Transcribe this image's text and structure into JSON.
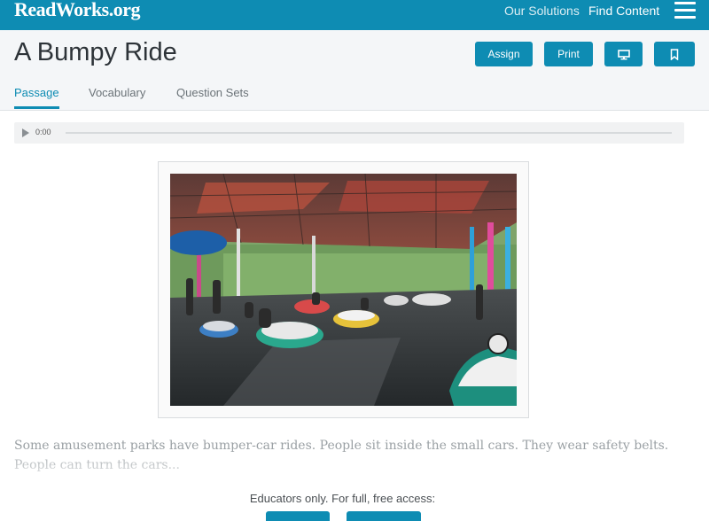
{
  "header": {
    "logo": "ReadWorks.org",
    "nav": {
      "solutions": "Our Solutions",
      "find_content": "Find Content"
    },
    "menu_icon": "hamburger-icon",
    "brand_color": "#0e8cb3"
  },
  "article": {
    "title": "A Bumpy Ride",
    "actions": {
      "assign": "Assign",
      "print": "Print",
      "screen_icon": "monitor-icon",
      "bookmark_icon": "bookmark-icon"
    },
    "tabs": [
      {
        "label": "Passage",
        "active": true
      },
      {
        "label": "Vocabulary",
        "active": false
      },
      {
        "label": "Question Sets",
        "active": false
      }
    ]
  },
  "audio": {
    "time": "0:00",
    "play_icon": "play-icon"
  },
  "passage": {
    "text": "Some amusement parks have bumper-car rides. People sit inside the small cars. They wear safety belts. People can turn the cars..."
  },
  "access_gate": {
    "message": "Educators only. For full, free access:"
  }
}
